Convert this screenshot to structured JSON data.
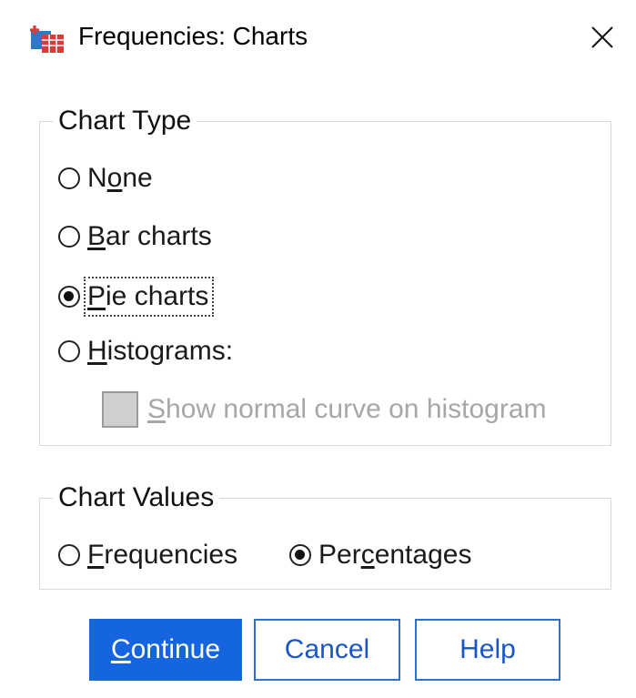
{
  "window": {
    "title": "Frequencies: Charts",
    "icon": "spss-app-icon",
    "close_icon": "close-icon"
  },
  "chart_type": {
    "legend": "Chart Type",
    "options": [
      {
        "pre": "N",
        "mn": "o",
        "post": "ne",
        "checked": false
      },
      {
        "pre": "",
        "mn": "B",
        "post": "ar charts",
        "checked": false
      },
      {
        "pre": "",
        "mn": "P",
        "post": "ie charts",
        "checked": true,
        "focused": true
      },
      {
        "pre": "",
        "mn": "H",
        "post": "istograms:",
        "checked": false
      }
    ],
    "normal_curve": {
      "pre": "",
      "mn": "S",
      "post": "how normal curve on histogram",
      "checked": false,
      "enabled": false
    }
  },
  "chart_values": {
    "legend": "Chart Values",
    "frequencies": {
      "pre": "",
      "mn": "F",
      "post": "requencies",
      "checked": false
    },
    "percentages": {
      "pre": "Per",
      "mn": "c",
      "post": "entages",
      "checked": true
    }
  },
  "buttons": {
    "continue": {
      "pre": "",
      "mn": "C",
      "post": "ontinue"
    },
    "cancel": "Cancel",
    "help": "Help"
  },
  "colors": {
    "primary_button": "#1565e0",
    "secondary_text": "#1a56c9",
    "disabled_text": "#a7a7a7"
  }
}
